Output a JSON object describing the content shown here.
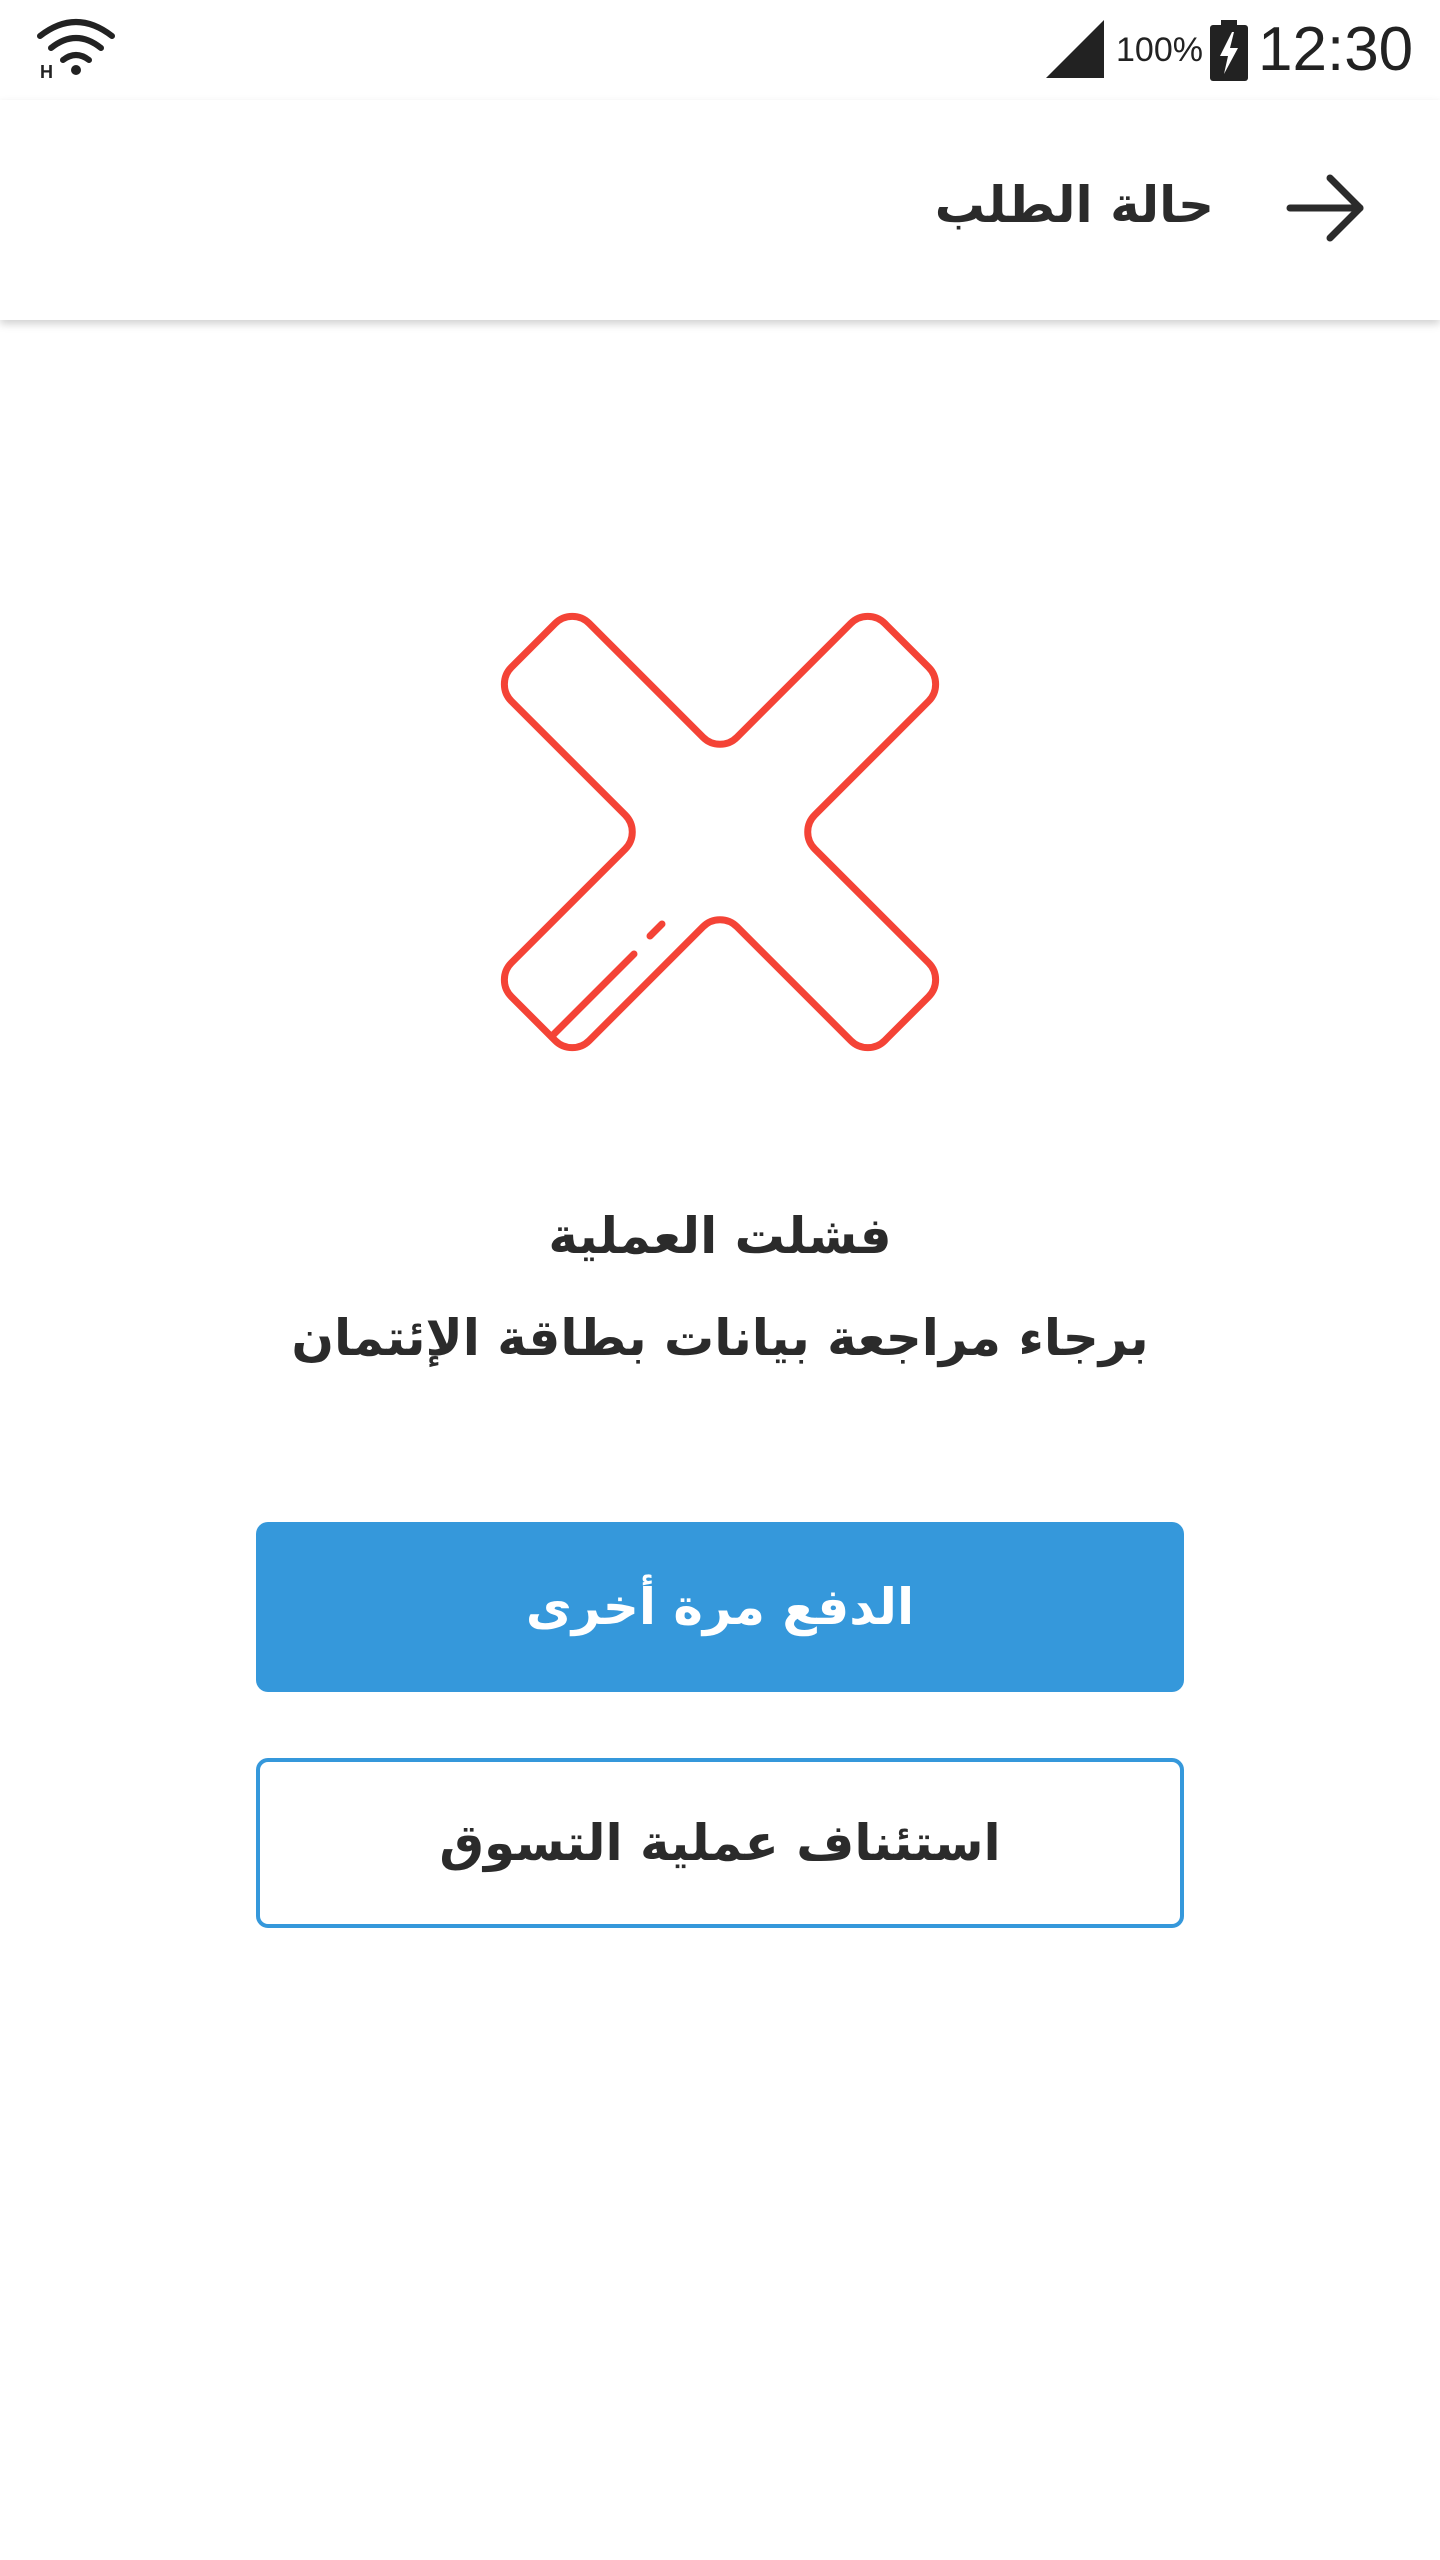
{
  "status_bar": {
    "wifi_icon": "wifi-icon",
    "signal_icon": "cellular-signal-icon",
    "battery_percent": "100%",
    "battery_icon": "battery-charging-icon",
    "time": "12:30"
  },
  "app_bar": {
    "title": "حالة الطلب",
    "back_icon": "arrow-right-icon"
  },
  "result": {
    "icon": "error-x-icon",
    "icon_color": "#f44336",
    "title": "فشلت العملية",
    "message": "برجاء مراجعة بيانات بطاقة الإئتمان"
  },
  "actions": {
    "retry_label": "الدفع مرة أخرى",
    "continue_label": "استئناف عملية التسوق",
    "primary_color": "#3598db"
  }
}
